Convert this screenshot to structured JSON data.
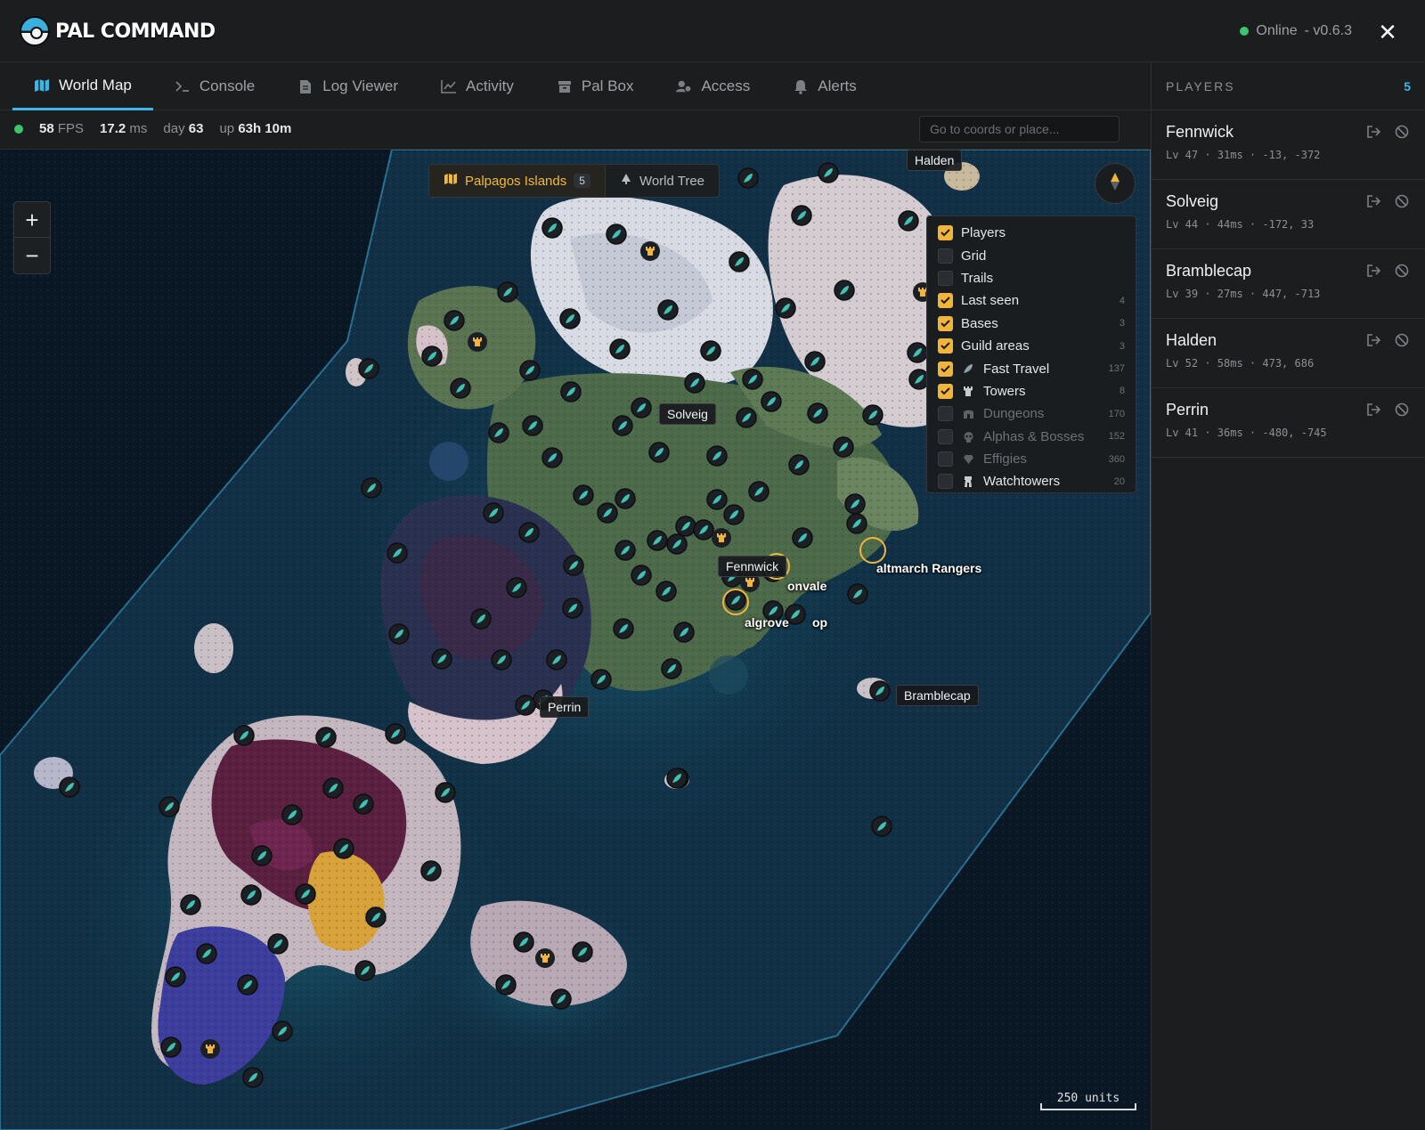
{
  "app": {
    "logo_text": "PAL COMMAND",
    "status_text": "Online",
    "version": "- v0.6.3",
    "close_label": "✕"
  },
  "tabs": [
    {
      "label": "World Map",
      "icon": "map-icon",
      "active": true
    },
    {
      "label": "Console",
      "icon": "terminal-icon"
    },
    {
      "label": "Log Viewer",
      "icon": "document-icon"
    },
    {
      "label": "Activity",
      "icon": "chart-icon"
    },
    {
      "label": "Pal Box",
      "icon": "box-icon"
    },
    {
      "label": "Access",
      "icon": "users-icon"
    },
    {
      "label": "Alerts",
      "icon": "bell-icon"
    }
  ],
  "stats": {
    "fps_value": "58",
    "fps_unit": "FPS",
    "ms_value": "17.2",
    "ms_unit": "ms",
    "day_label": "day",
    "day_value": "63",
    "uptime_label": "up",
    "uptime_value": "63h 10m"
  },
  "search": {
    "placeholder": "Go to coords or place..."
  },
  "map": {
    "zoom_in": "+",
    "zoom_out": "−",
    "regions": [
      {
        "label": "Palpagos Islands",
        "count": "5",
        "active": true
      },
      {
        "label": "World Tree"
      }
    ],
    "layers": [
      {
        "label": "Players",
        "checked": true,
        "count": ""
      },
      {
        "label": "Grid",
        "checked": false,
        "count": ""
      },
      {
        "label": "Trails",
        "checked": false,
        "count": ""
      },
      {
        "label": "Last seen",
        "checked": true,
        "count": "4"
      },
      {
        "label": "Bases",
        "checked": true,
        "count": "3"
      },
      {
        "label": "Guild areas",
        "checked": true,
        "count": "3"
      },
      {
        "label": "Fast Travel",
        "checked": true,
        "count": "137",
        "icon": "feather-icon"
      },
      {
        "label": "Towers",
        "checked": true,
        "count": "8",
        "icon": "tower-icon"
      },
      {
        "label": "Dungeons",
        "checked": false,
        "count": "170",
        "icon": "dungeon-icon",
        "dim": true
      },
      {
        "label": "Alphas & Bosses",
        "checked": false,
        "count": "152",
        "icon": "skull-icon",
        "dim": true
      },
      {
        "label": "Effigies",
        "checked": false,
        "count": "360",
        "icon": "gem-icon",
        "dim": true
      },
      {
        "label": "Watchtowers",
        "checked": false,
        "count": "20",
        "icon": "watchtower-icon"
      }
    ],
    "player_labels": [
      "Halden",
      "Solveig",
      "Fennwick",
      "Perrin",
      "Bramblecap"
    ],
    "guild_labels": [
      "altmarch Rangers",
      "onvale",
      "algrove",
      "op"
    ],
    "scale_label": "250 units",
    "colors": {
      "accent": "#3bb6e8",
      "gold": "#f0b53a",
      "ocean": "#0c1c2b",
      "online": "#3ec46d"
    }
  },
  "players_panel": {
    "title": "PLAYERS",
    "count": "5",
    "players": [
      {
        "name": "Fennwick",
        "meta": "Lv 47 · 31ms · -13, -372"
      },
      {
        "name": "Solveig",
        "meta": "Lv 44 · 44ms · -172, 33"
      },
      {
        "name": "Bramblecap",
        "meta": "Lv 39 · 27ms · 447, -713"
      },
      {
        "name": "Halden",
        "meta": "Lv 52 · 58ms · 473, 686"
      },
      {
        "name": "Perrin",
        "meta": "Lv 41 · 36ms · -480, -745"
      }
    ]
  }
}
